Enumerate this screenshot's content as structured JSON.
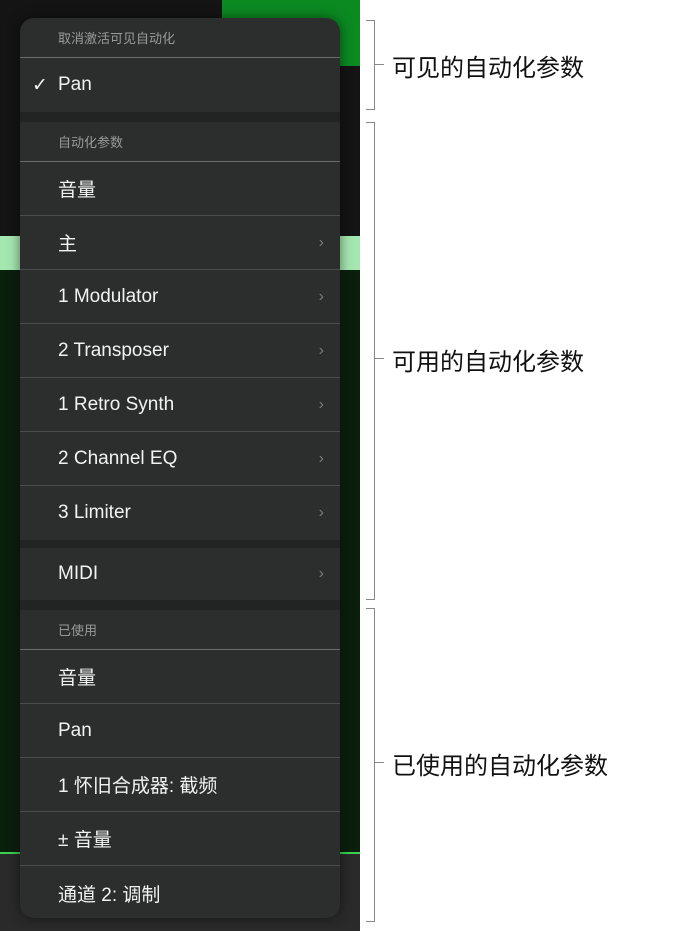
{
  "menu": {
    "visible_header": "取消激活可见自动化",
    "visible_items": [
      {
        "label": "Pan",
        "checked": true
      }
    ],
    "params_header": "自动化参数",
    "params_items": [
      {
        "label": "音量",
        "submenu": false
      },
      {
        "label": "主",
        "submenu": true
      },
      {
        "label": "1 Modulator",
        "submenu": true
      },
      {
        "label": "2 Transposer",
        "submenu": true
      },
      {
        "label": "1 Retro Synth",
        "submenu": true
      },
      {
        "label": "2 Channel EQ",
        "submenu": true
      },
      {
        "label": "3 Limiter",
        "submenu": true
      }
    ],
    "midi": {
      "label": "MIDI",
      "submenu": true
    },
    "used_header": "已使用",
    "used_items": [
      {
        "label": "音量"
      },
      {
        "label": "Pan"
      },
      {
        "label": "1 怀旧合成器: 截频"
      },
      {
        "label": "± 音量"
      },
      {
        "label": "通道 2: 调制"
      }
    ]
  },
  "icons": {
    "check": "✓",
    "chevron": "›"
  },
  "callouts": [
    "可见的自动化参数",
    "可用的自动化参数",
    "已使用的自动化参数"
  ]
}
